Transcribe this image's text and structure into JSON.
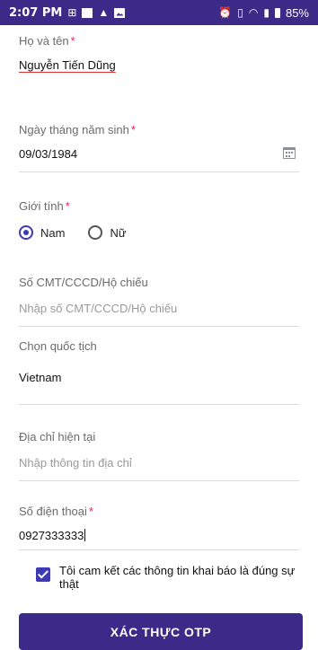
{
  "status_bar": {
    "time": "2:07 PM",
    "battery": "85%"
  },
  "form": {
    "full_name": {
      "label": "Họ và tên",
      "required_mark": "*",
      "value": "Nguyễn Tiến Dũng"
    },
    "dob": {
      "label": "Ngày tháng năm sinh",
      "required_mark": "*",
      "value": "09/03/1984"
    },
    "gender": {
      "label": "Giới tính",
      "required_mark": "*",
      "options": [
        {
          "label": "Nam",
          "selected": true
        },
        {
          "label": "Nữ",
          "selected": false
        }
      ]
    },
    "id_number": {
      "label": "Số CMT/CCCD/Hộ chiếu",
      "placeholder": "Nhập số CMT/CCCD/Hộ chiếu"
    },
    "nationality": {
      "label": "Chọn quốc tịch",
      "value": "Vietnam"
    },
    "address": {
      "label": "Địa chỉ hiện tại",
      "placeholder": "Nhập thông tin địa chỉ"
    },
    "phone": {
      "label": "Số điện thoại",
      "required_mark": "*",
      "value": "0927333333"
    },
    "agreement": {
      "text": "Tôi cam kết các thông tin khai báo là đúng sự thật",
      "checked": true
    }
  },
  "actions": {
    "otp_button": "XÁC THỰC OTP"
  },
  "colors": {
    "primary": "#3b2a88",
    "accent": "#3d3ab6",
    "required": "#e0245e"
  },
  "icons": [
    "calendar-icon",
    "checkbox-icon",
    "radio-icon",
    "wifi-icon",
    "signal-icon",
    "battery-icon",
    "alarm-icon",
    "vibrate-icon"
  ]
}
